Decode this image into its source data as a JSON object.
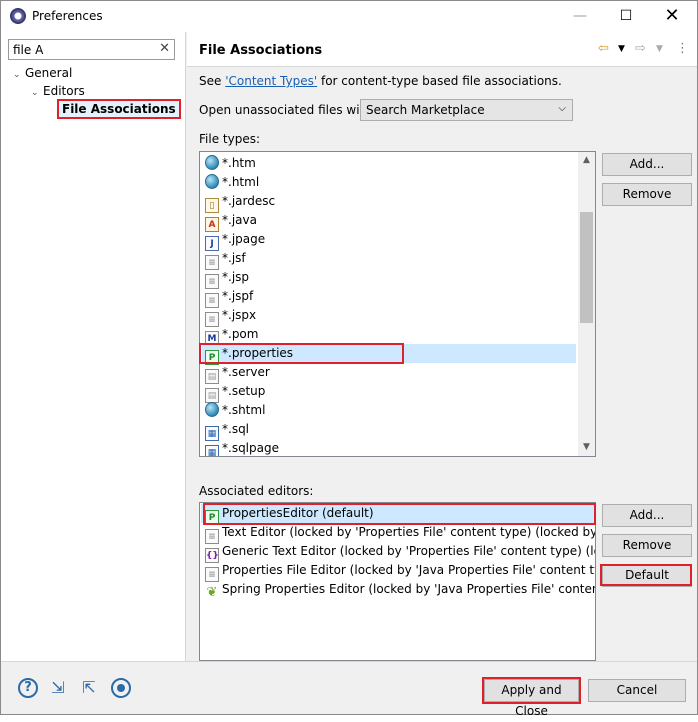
{
  "window": {
    "title": "Preferences",
    "minimize": "—",
    "maximize": "☐",
    "close": "✕"
  },
  "filter": {
    "value": "file A",
    "clear": "✕"
  },
  "tree": [
    {
      "label": "General",
      "twisty": "⌄"
    },
    {
      "label": "Editors",
      "twisty": "⌄"
    },
    {
      "label": "File Associations"
    }
  ],
  "page": {
    "title": "File Associations",
    "see_prefix": "See ",
    "see_link": "'Content Types'",
    "see_suffix": " for content-type based file associations.",
    "open_label": "Open unassociated files with:",
    "open_value": "Search Marketplace",
    "file_types_label": "File types:",
    "editors_label": "Associated editors:"
  },
  "file_types": [
    {
      "name": "*.htm",
      "icon": "globe-icon"
    },
    {
      "name": "*.html",
      "icon": "globe-icon"
    },
    {
      "name": "*.jardesc",
      "icon": "jar-icon"
    },
    {
      "name": "*.java",
      "icon": "java-icon"
    },
    {
      "name": "*.jpage",
      "icon": "j-icon"
    },
    {
      "name": "*.jsf",
      "icon": "doc-icon"
    },
    {
      "name": "*.jsp",
      "icon": "doc-icon"
    },
    {
      "name": "*.jspf",
      "icon": "doc-icon"
    },
    {
      "name": "*.jspx",
      "icon": "doc-icon"
    },
    {
      "name": "*.pom",
      "icon": "maven-icon"
    },
    {
      "name": "*.properties",
      "icon": "properties-icon",
      "selected": true
    },
    {
      "name": "*.server",
      "icon": "server-icon"
    },
    {
      "name": "*.setup",
      "icon": "setup-icon"
    },
    {
      "name": "*.shtml",
      "icon": "globe-icon"
    },
    {
      "name": "*.sql",
      "icon": "sql-icon"
    },
    {
      "name": "*.sqlpage",
      "icon": "sql-icon"
    }
  ],
  "editors": [
    {
      "name": "PropertiesEditor (default)",
      "icon": "properties-icon",
      "selected": true
    },
    {
      "name": "Text Editor (locked by 'Properties File' content type) (locked by 'Java",
      "icon": "doc-icon"
    },
    {
      "name": "Generic Text Editor (locked by 'Properties File' content type) (locked b",
      "icon": "generic-editor-icon"
    },
    {
      "name": "Properties File Editor (locked by 'Java Properties File' content type) (lo",
      "icon": "doc-icon"
    },
    {
      "name": "Spring Properties Editor (locked by 'Java Properties File' content type)",
      "icon": "spring-leaf-icon"
    }
  ],
  "buttons": {
    "file_add": "Add...",
    "file_remove": "Remove",
    "editor_add": "Add...",
    "editor_remove": "Remove",
    "editor_default": "Default",
    "apply_close": "Apply and Close",
    "cancel": "Cancel"
  },
  "colors": {
    "highlight": "#e0202a",
    "link": "#1a5fb4",
    "selection": "#cde8ff"
  }
}
